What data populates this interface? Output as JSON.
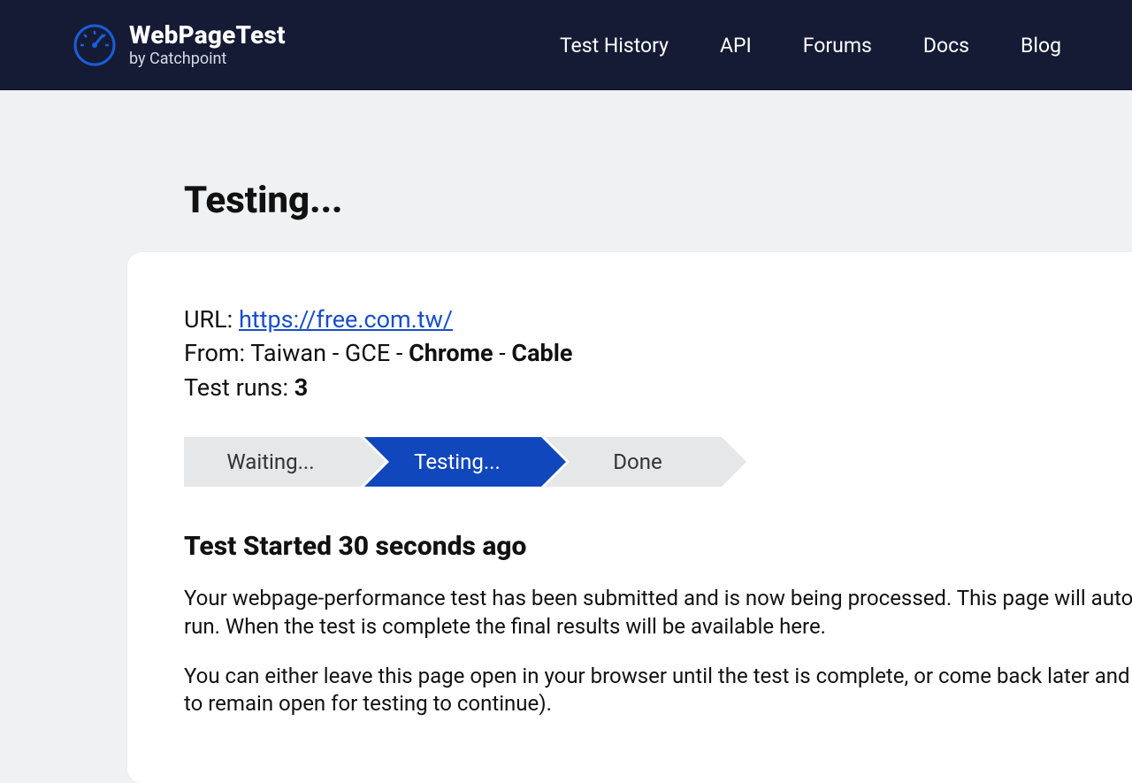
{
  "header": {
    "brand_title": "WebPageTest",
    "brand_subtitle": "by Catchpoint",
    "nav": [
      "Test History",
      "API",
      "Forums",
      "Docs",
      "Blog"
    ]
  },
  "page": {
    "title": "Testing..."
  },
  "test": {
    "url_label": "URL: ",
    "url": "https://free.com.tw/",
    "from_prefix": "From: ",
    "from_location": "Taiwan - GCE - ",
    "from_browser": "Chrome",
    "from_sep": " - ",
    "from_connection": "Cable",
    "runs_label": "Test runs: ",
    "runs": "3"
  },
  "steps": {
    "waiting": "Waiting...",
    "testing": "Testing...",
    "done": "Done"
  },
  "status": {
    "heading": "Test Started 30 seconds ago",
    "p1": "Your webpage-performance test has been submitted and is now being processed. This page will automatically run. When the test is complete the final results will be available here.",
    "p2": "You can either leave this page open in your browser until the test is complete, or come back later and check on to remain open for testing to continue)."
  }
}
